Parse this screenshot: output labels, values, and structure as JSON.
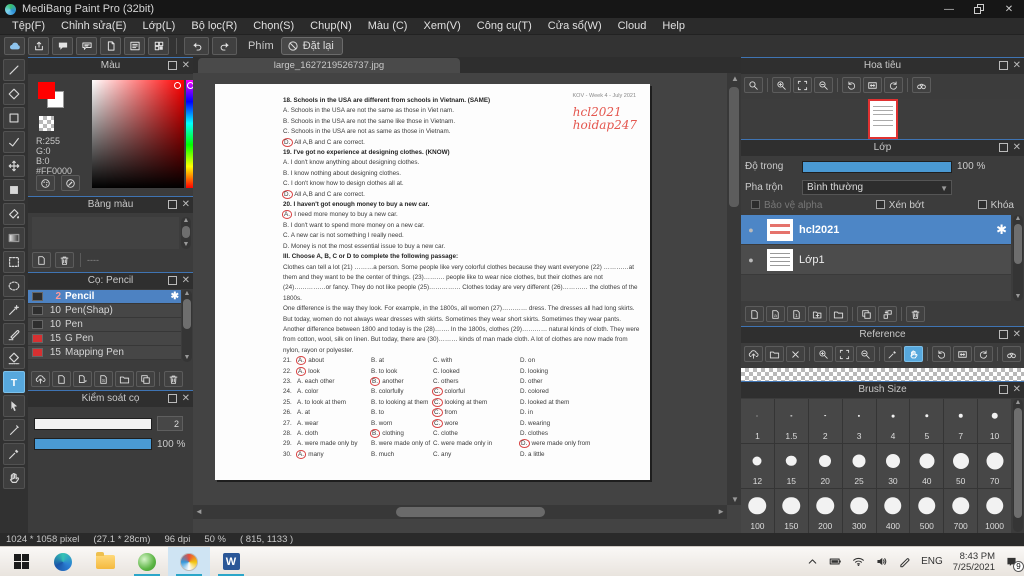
{
  "window": {
    "title": "MediBang Paint Pro (32bit)"
  },
  "menu": {
    "items": [
      "Tệp(F)",
      "Chỉnh sửa(E)",
      "Lớp(L)",
      "Bộ lọc(R)",
      "Chọn(S)",
      "Chụp(N)",
      "Màu (C)",
      "Xem(V)",
      "Công cụ(T)",
      "Cửa sổ(W)",
      "Cloud",
      "Help"
    ]
  },
  "toolbar": {
    "buttons": [
      "cloudsync",
      "share",
      "comment",
      "commentpanel",
      "docicon",
      "listicon",
      "gridicon"
    ],
    "keys_label": "Phím",
    "reset_button": "Đặt lại"
  },
  "tools": [
    {
      "icon": "pen",
      "name": "pen-tool"
    },
    {
      "icon": "eraser",
      "name": "eraser-tool"
    },
    {
      "icon": "rect",
      "name": "shape-brush-tool"
    },
    {
      "icon": "checkpen",
      "name": "dot-pen-tool"
    },
    {
      "icon": "move",
      "name": "move-tool"
    },
    {
      "icon": "fillrect",
      "name": "fill-rect-tool"
    },
    {
      "icon": "bucket",
      "name": "bucket-tool"
    },
    {
      "icon": "gradient",
      "name": "gradient-tool"
    },
    {
      "icon": "select",
      "name": "select-rect-tool"
    },
    {
      "icon": "lasso",
      "name": "lasso-select-tool"
    },
    {
      "icon": "wand",
      "name": "magic-wand-tool"
    },
    {
      "icon": "selectpen",
      "name": "select-pen-tool"
    },
    {
      "icon": "selecteraser",
      "name": "select-eraser-tool"
    },
    {
      "icon": "text",
      "name": "text-tool",
      "active": true
    },
    {
      "icon": "pointer",
      "name": "operation-tool"
    },
    {
      "icon": "knife",
      "name": "divide-tool"
    },
    {
      "icon": "dropper",
      "name": "eyedropper-tool"
    },
    {
      "icon": "hand",
      "name": "hand-tool"
    }
  ],
  "panels": {
    "color": {
      "title": "Màu",
      "r": "R:255",
      "g": "G:0",
      "b": "B:0",
      "hex": "#FF0000",
      "buttons": [
        "color-wheel",
        "color-picker"
      ]
    },
    "palette": {
      "title": "Bảng màu",
      "placeholder": "----",
      "buttons": [
        "newdoc",
        "trash"
      ]
    },
    "brush": {
      "title": "Cọ: Pencil",
      "items": [
        {
          "size": "2",
          "name": "Pencil",
          "selected": true,
          "swatch": "#2e2e2e"
        },
        {
          "size": "10",
          "name": "Pen(Shap)",
          "selected": false,
          "swatch": "#2e2e2e"
        },
        {
          "size": "10",
          "name": "Pen",
          "selected": false,
          "swatch": "#2e2e2e"
        },
        {
          "size": "15",
          "name": "G Pen",
          "selected": false,
          "swatch": "#d63031"
        },
        {
          "size": "15",
          "name": "Mapping Pen",
          "selected": false,
          "swatch": "#d63031"
        }
      ],
      "buttons": [
        "uploadcloud",
        "newdoc",
        "docarrow",
        "docs",
        "folder",
        "copy",
        "|",
        "trash"
      ]
    },
    "brush_control": {
      "title": "Kiểm soát cọ",
      "size_value": "2",
      "opacity_value": "100 %"
    },
    "navigator": {
      "title": "Hoa tiêu",
      "toolbar": [
        "magnifier",
        "|",
        "zoomin",
        "fit",
        "zoomout",
        "|",
        "rotateccw",
        "fitwidth",
        "rotatecw",
        "|",
        "binoculars"
      ]
    },
    "layers": {
      "title": "Lớp",
      "opacity_label": "Độ trong",
      "opacity_value": "100 %",
      "blend_label": "Pha trộn",
      "blend_value": "Bình thường",
      "checkboxes": [
        "Bảo vệ alpha",
        "Xén bớt",
        "Khóa"
      ],
      "items": [
        {
          "name": "hcl2021",
          "selected": true
        },
        {
          "name": "Lớp1",
          "selected": false
        }
      ],
      "buttons": [
        "newdoc",
        "doca",
        "doc1",
        "folderplus",
        "folder",
        "|",
        "copy",
        "merge",
        "|",
        "trash"
      ]
    },
    "reference": {
      "title": "Reference",
      "toolbar": [
        "uploadcloud",
        "folder",
        "x",
        "|",
        "zoomin",
        "fit",
        "zoomout",
        "|",
        "dropper",
        "hand:active",
        "|",
        "rotateccw",
        "fitwidth",
        "rotatecw",
        "|",
        "binoculars"
      ]
    },
    "brush_size": {
      "title": "Brush Size",
      "sizes": [
        "1",
        "1.5",
        "2",
        "3",
        "4",
        "5",
        "7",
        "10",
        "12",
        "15",
        "20",
        "25",
        "30",
        "40",
        "50",
        "70",
        "100",
        "150",
        "200",
        "300",
        "400",
        "500",
        "700",
        "1000"
      ]
    }
  },
  "canvas": {
    "tab_title": "large_1627219526737.jpg"
  },
  "document": {
    "header": "KOV - Week 4 - July 2021",
    "watermark": [
      "hcl2021",
      "hoidap247"
    ],
    "questions": [
      {
        "number": "18.",
        "text": "Schools in the USA are different from schools in Vietnam. (SAME)",
        "choices": [
          "Schools in the USA are not the same as those in Viet nam.",
          "Schools in the USA are not the same like those in Vietnam.",
          "Schools in the USA are not as same as those in Vietnam.",
          "All A,B and C are correct."
        ],
        "answer": 3
      },
      {
        "number": "19.",
        "text": "I've got no experience at designing clothes. (KNOW)",
        "choices": [
          "I don't know anything about designing clothes.",
          "I know nothing about designing clothes.",
          "I don't know how to design clothes all at.",
          "All A,B and C are correct."
        ],
        "answer": 3
      },
      {
        "number": "20.",
        "text": "I haven't got enough money to buy a new car.",
        "choices": [
          "I need more money to buy a new car.",
          "I don't want to spend more money on a new car.",
          "A new car is not something I really need.",
          "Money is not the most essential issue to buy a new car."
        ],
        "answer": 0
      }
    ],
    "section_title": "III. Choose A, B, C or D to complete the following passage:",
    "passage": [
      "Clothes can tell a lot (21) ………a person. Some people like very colorful clothes because they want everyone (22) …………at them and they want to be the center of things. (23)………. people like to wear nice clothes, but their clothes are not (24)……………or fancy. They do not like people (25)…………… Clothes today are very different (26)………… the clothes of the 1800s.",
      "One difference is the way they look. For example, in the 1800s, all women (27)………… dress. The dresses all had long skirts. But today, women do not always wear dresses with skirts. Sometimes they wear short skirts. Sometimes they wear pants. Another difference between 1800 and today is the (28)……. In the 1800s, clothes (29)………… natural kinds of cloth. They were from cotton, wool, silk on linen. But today, there are (30)……… kinds of man made cloth. A lot of clothes are now made from nylon, rayon or polyester."
    ],
    "mcq": [
      {
        "number": "21.",
        "options": [
          "about",
          "at",
          "with",
          "on"
        ],
        "answer": 0
      },
      {
        "number": "22.",
        "options": [
          "look",
          "to look",
          "looked",
          "looking"
        ],
        "answer": 0
      },
      {
        "number": "23.",
        "options": [
          "each other",
          "another",
          "others",
          "other"
        ],
        "answer": 1
      },
      {
        "number": "24.",
        "options": [
          "color",
          "colorfully",
          "colorful",
          "colored"
        ],
        "answer": 2
      },
      {
        "number": "25.",
        "options": [
          "to look at them",
          "to looking at them",
          "looking at them",
          "looked at them"
        ],
        "answer": 2
      },
      {
        "number": "26.",
        "options": [
          "at",
          "to",
          "from",
          "in"
        ],
        "answer": 2
      },
      {
        "number": "27.",
        "options": [
          "wear",
          "worn",
          "wore",
          "wearing"
        ],
        "answer": 2
      },
      {
        "number": "28.",
        "options": [
          "cloth",
          "clothing",
          "clothe",
          "clothes"
        ],
        "answer": 1
      },
      {
        "number": "29.",
        "options": [
          "were made only by",
          "were made only of",
          "were made only in",
          "were made only from"
        ],
        "answer": 3
      },
      {
        "number": "30.",
        "options": [
          "many",
          "much",
          "any",
          "a little"
        ],
        "answer": 0
      }
    ]
  },
  "status_bar": {
    "dimensions": "1024 * 1058 pixel",
    "size_cm": "(27.1 * 28cm)",
    "dpi": "96 dpi",
    "zoom": "50 %",
    "coords": "( 815, 1133 )"
  },
  "taskbar": {
    "language": "ENG",
    "time": "8:43 PM",
    "date": "7/25/2021",
    "notification_count": "9"
  }
}
